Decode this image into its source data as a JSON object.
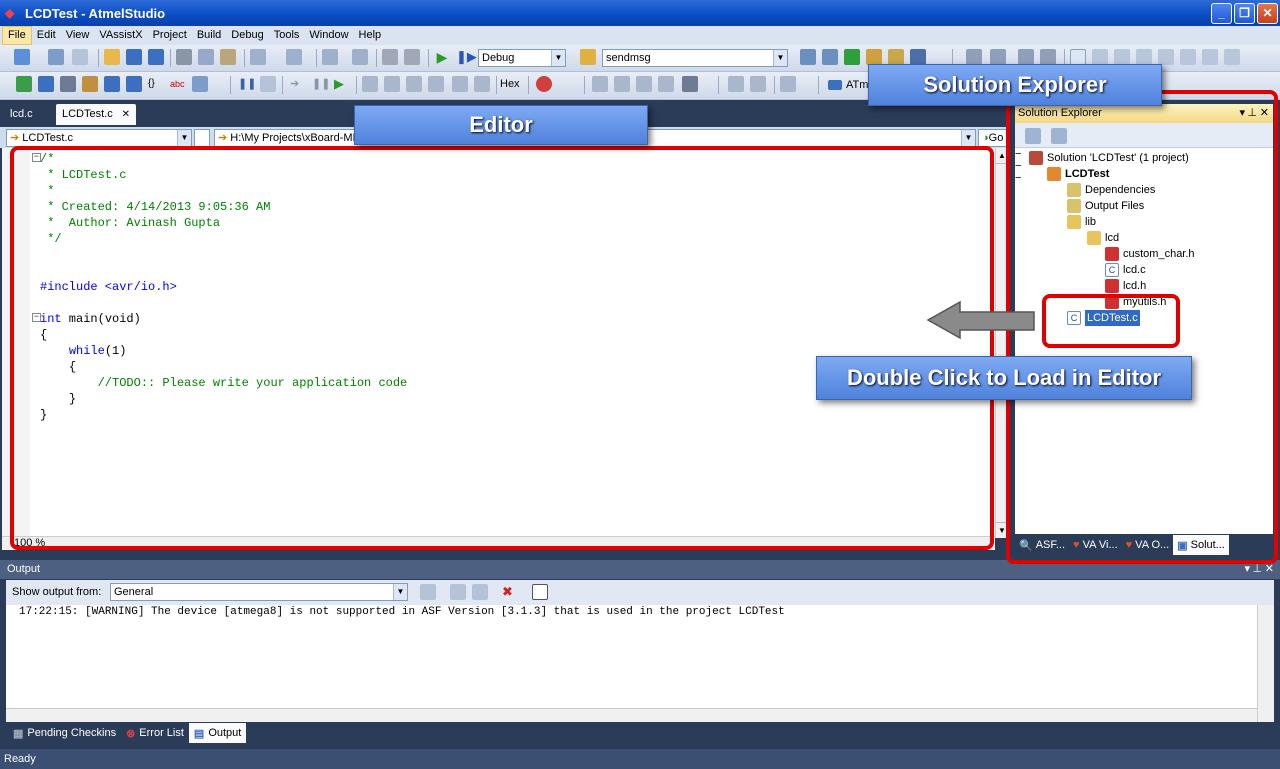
{
  "window": {
    "title": "LCDTest - AtmelStudio"
  },
  "menu": [
    "File",
    "Edit",
    "View",
    "VAssistX",
    "Project",
    "Build",
    "Debug",
    "Tools",
    "Window",
    "Help"
  ],
  "toolbar": {
    "config": "Debug",
    "find": "sendmsg",
    "hex_label": "Hex",
    "device": "ATmega8"
  },
  "tabs": [
    "lcd.c",
    "LCDTest.c"
  ],
  "nav": {
    "file": "LCDTest.c",
    "path": "H:\\My Projects\\xBoard-MINI-v2\\AS6 Projects\\LCDTest\\LCDTest\\LCDTest.c",
    "go": "Go"
  },
  "code": {
    "l1": "/*",
    "l2": " * LCDTest.c",
    "l3": " *",
    "l4": " * Created: 4/14/2013 9:05:36 AM",
    "l5": " *  Author: Avinash Gupta",
    "l6": " */",
    "inc": "#include <avr/io.h>",
    "int_kw": "int",
    "main_sig": " main(void)",
    "ob1": "{",
    "while_kw": "while",
    "while_arg": "(1)",
    "ob2": "{",
    "todo": "//TODO:: Please write your application code",
    "cb2": "}",
    "cb1": "}"
  },
  "zoom": "100 %",
  "solution_explorer": {
    "title": "Solution Explorer",
    "solution": "Solution 'LCDTest' (1 project)",
    "project": "LCDTest",
    "dependencies": "Dependencies",
    "output_files": "Output Files",
    "lib": "lib",
    "lcd": "lcd",
    "custom_char": "custom_char.h",
    "lcd_c": "lcd.c",
    "lcd_h": "lcd.h",
    "myutils": "myutils.h",
    "lcdtest_c": "LCDTest.c",
    "tabs": [
      "ASF...",
      "VA Vi...",
      "VA O...",
      "Solut..."
    ]
  },
  "output": {
    "title": "Output",
    "show_from_label": "Show output from:",
    "source": "General",
    "line": "17:22:15: [WARNING] The device [atmega8] is not supported in ASF Version [3.1.3] that is used in the project LCDTest"
  },
  "bottom_tabs": [
    "Pending Checkins",
    "Error List",
    "Output"
  ],
  "status": "Ready",
  "callouts": {
    "solution_explorer": "Solution Explorer",
    "editor": "Editor",
    "double_click": "Double Click to Load in Editor"
  },
  "colors": {
    "highlight": "#e00000",
    "callout": "#4f82dc",
    "comment": "#008000",
    "keyword": "#0000ff"
  }
}
